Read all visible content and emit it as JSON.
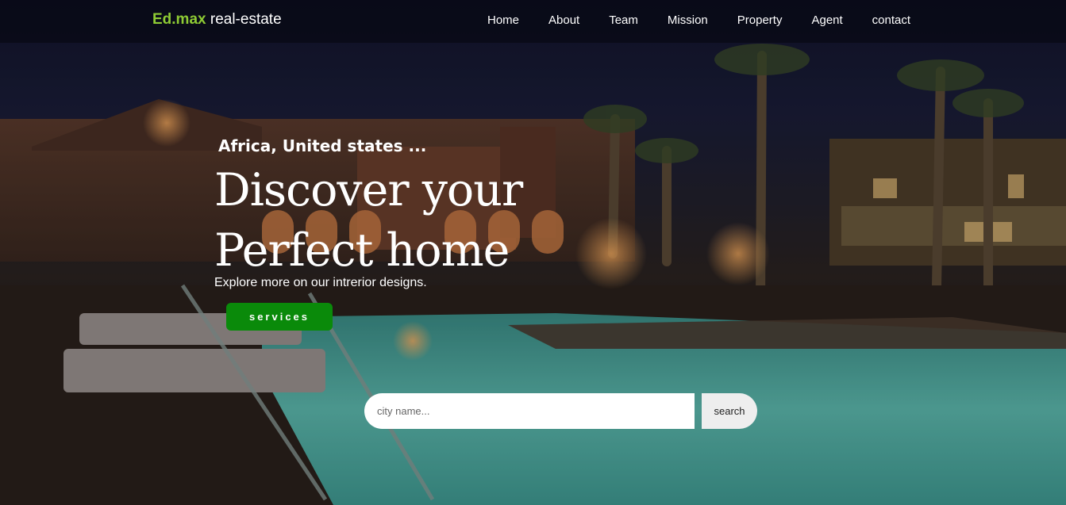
{
  "nav": {
    "brand_accent": "Ed.max",
    "brand_rest": " real-estate",
    "links": [
      "Home",
      "About",
      "Team",
      "Mission",
      "Property",
      "Agent",
      "contact"
    ]
  },
  "hero": {
    "location": "Africa, United states ...",
    "headline_line1": "Discover your",
    "headline_line2": "Perfect home",
    "subtitle": "Explore more on our intrerior designs.",
    "services_label": "services"
  },
  "search": {
    "placeholder": "city name...",
    "button_label": "search"
  },
  "colors": {
    "brand_accent": "#8ecb34",
    "services_button": "#0a8a0a",
    "nav_background": "#080a16"
  }
}
